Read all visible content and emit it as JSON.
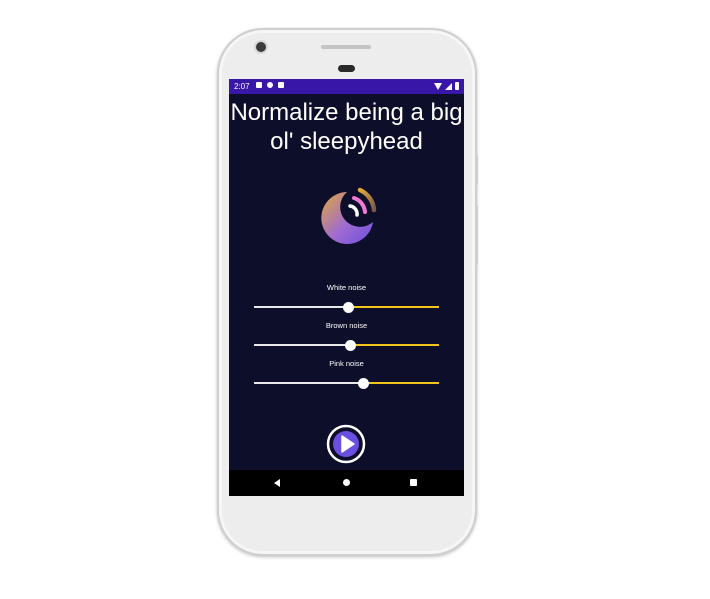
{
  "status_bar": {
    "time": "2:07"
  },
  "header": {
    "title": "Normalize being a big ol' sleepyhead"
  },
  "logo": {
    "icon": "moon-sound-icon"
  },
  "sliders": [
    {
      "label": "White noise",
      "value_percent": 51
    },
    {
      "label": "Brown noise",
      "value_percent": 52
    },
    {
      "label": "Pink noise",
      "value_percent": 59
    }
  ],
  "controls": {
    "play_icon": "play-icon"
  },
  "navigation": {
    "back_icon": "back-icon",
    "home_icon": "home-icon",
    "recents_icon": "recents-icon"
  },
  "colors": {
    "background": "#0c0e2a",
    "status_bar": "#3716a8",
    "slider_active": "#e8e8e8",
    "slider_inactive": "#f0c419",
    "accent_purple": "#6b4fe0",
    "accent_gold": "#e0a93a",
    "accent_pink": "#f27ad6"
  }
}
